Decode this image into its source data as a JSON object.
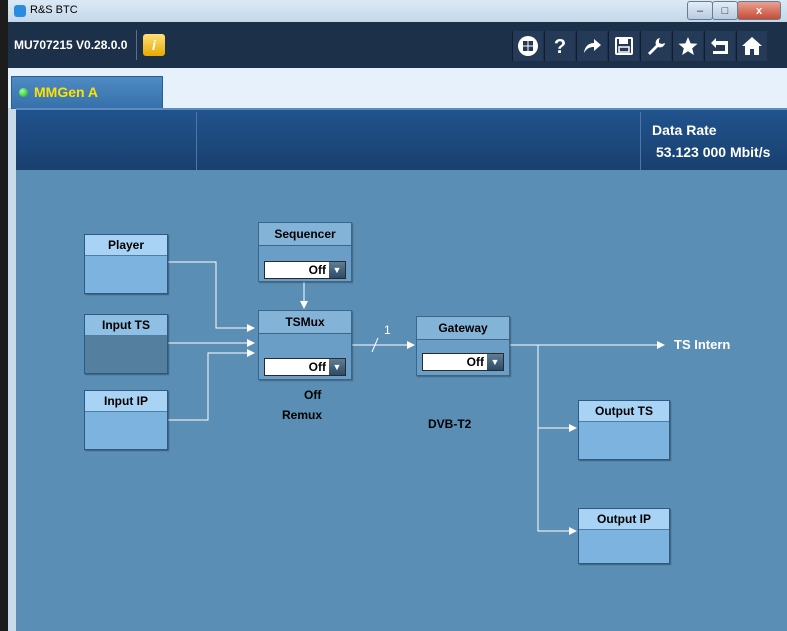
{
  "window": {
    "title": "R&S BTC",
    "min": "–",
    "max": "□",
    "close": "x"
  },
  "toolbar": {
    "version": "MU707215 V0.28.0.0",
    "info_glyph": "i"
  },
  "tab": {
    "label": "MMGen A"
  },
  "header": {
    "data_rate_label": "Data Rate",
    "data_rate_value": "53.123 000 Mbit/s"
  },
  "diagram": {
    "player": "Player",
    "input_ts": "Input TS",
    "input_ip": "Input IP",
    "sequencer": {
      "title": "Sequencer",
      "value": "Off"
    },
    "tsmux": {
      "title": "TSMux",
      "value": "Off",
      "status": "Off",
      "mode": "Remux"
    },
    "gateway": {
      "title": "Gateway",
      "value": "Off",
      "standard": "DVB-T2"
    },
    "link_count": "1",
    "ts_intern": "TS Intern",
    "output_ts": "Output TS",
    "output_ip": "Output IP"
  },
  "colors": {
    "canvas": "#5b8eb5",
    "tab_text": "#ffe000",
    "toolbar": "#1d3049"
  }
}
